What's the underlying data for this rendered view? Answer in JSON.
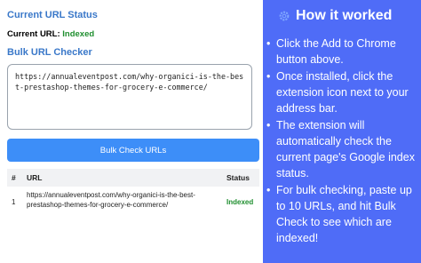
{
  "left": {
    "current_url_title": "Current URL Status",
    "current_url_label": "Current URL:",
    "current_url_status": "Indexed",
    "bulk_title": "Bulk URL Checker",
    "textarea_value": "https://annualeventpost.com/why-organici-is-the-best-prestashop-themes-for-grocery-e-commerce/",
    "button_label": "Bulk Check URLs",
    "table": {
      "headers": {
        "num": "#",
        "url": "URL",
        "status": "Status"
      },
      "rows": [
        {
          "num": "1",
          "url": "https://annualeventpost.com/why-organici-is-the-best-prestashop-themes-for-grocery-e-commerce/",
          "status": "Indexed"
        }
      ]
    }
  },
  "right": {
    "title": "How it worked",
    "icon": "gear-icon",
    "bullets": [
      "Click the Add to Chrome button above.",
      "Once installed, click the extension icon next to your address bar.",
      "The extension will automatically check the current page's Google index status.",
      "For bulk checking, paste up to 10 URLs, and hit Bulk Check to see which are indexed!"
    ]
  },
  "colors": {
    "accent_blue": "#3d8ef8",
    "panel_blue": "#4f6cf7",
    "title_blue": "#3a78c9",
    "indexed_green": "#1e8e2e"
  }
}
